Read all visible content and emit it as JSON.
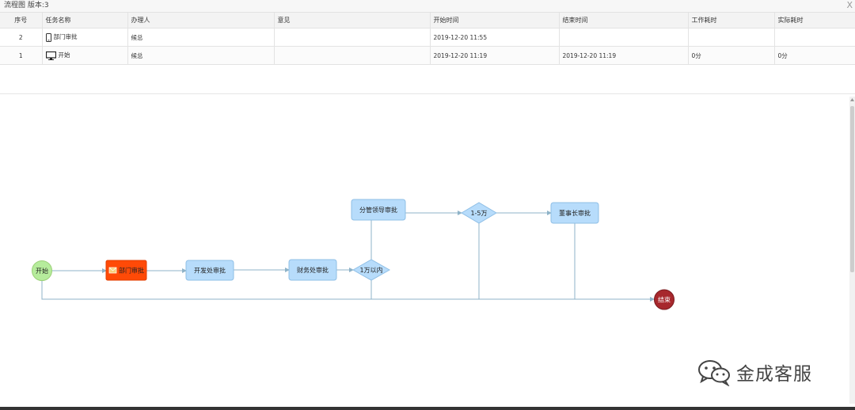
{
  "window": {
    "title": "流程图 版本:3",
    "close_label": "X"
  },
  "table": {
    "headers": [
      "序号",
      "任务名称",
      "办理人",
      "意见",
      "开始时间",
      "结束时间",
      "工作耗时",
      "实际耗时"
    ],
    "rows": [
      {
        "seq": "2",
        "icon": "mobile-phone-icon",
        "task": "部门审批",
        "handler": "候总",
        "opinion": "",
        "start": "2019-12-20 11:55",
        "end": "",
        "work_time": "",
        "actual_time": ""
      },
      {
        "seq": "1",
        "icon": "monitor-icon",
        "task": "开始",
        "handler": "候总",
        "opinion": "",
        "start": "2019-12-20 11:19",
        "end": "2019-12-20 11:19",
        "work_time": "0分",
        "actual_time": "0分"
      }
    ]
  },
  "flow": {
    "start": {
      "label": "开始",
      "color": "#b6ec9c"
    },
    "dept": {
      "label": "部门审批",
      "color": "#ff4a07",
      "icon": "envelope-icon"
    },
    "dev": {
      "label": "开发处审批",
      "color": "#b7dcfb"
    },
    "finance": {
      "label": "财务处审批",
      "color": "#b7dcfb"
    },
    "lt1w": {
      "label": "1万以内",
      "color": "#b7dcfb"
    },
    "branch": {
      "label": "分管领导审批",
      "color": "#b7dcfb"
    },
    "r15": {
      "label": "1-5万",
      "color": "#b7dcfb"
    },
    "chair": {
      "label": "董事长审批",
      "color": "#b7dcfb"
    },
    "end": {
      "label": "结束",
      "color": "#a7282d"
    }
  },
  "watermark": {
    "text": "金成客服",
    "icon": "wechat-icon"
  }
}
